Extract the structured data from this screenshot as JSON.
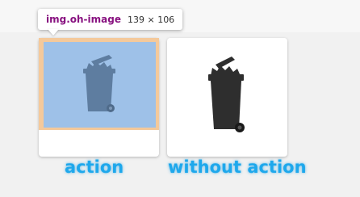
{
  "tooltip": {
    "element_name": "img.oh-image",
    "dimensions": "139 × 106"
  },
  "cards": [
    {
      "caption": "action",
      "image_icon": "trash-bin-icon",
      "highlighted": true
    },
    {
      "caption": "without action",
      "image_icon": "trash-bin-icon",
      "highlighted": false
    }
  ],
  "colors": {
    "page_background": "#f1f1f1",
    "highlight_content": "#9ec1e8",
    "highlight_margin": "#f4c99b",
    "bin_dark": "#2e2e2e",
    "bin_tinted": "#5e7da0",
    "caption_text": "#1ea8ec",
    "tooltip_tag": "#881280"
  }
}
